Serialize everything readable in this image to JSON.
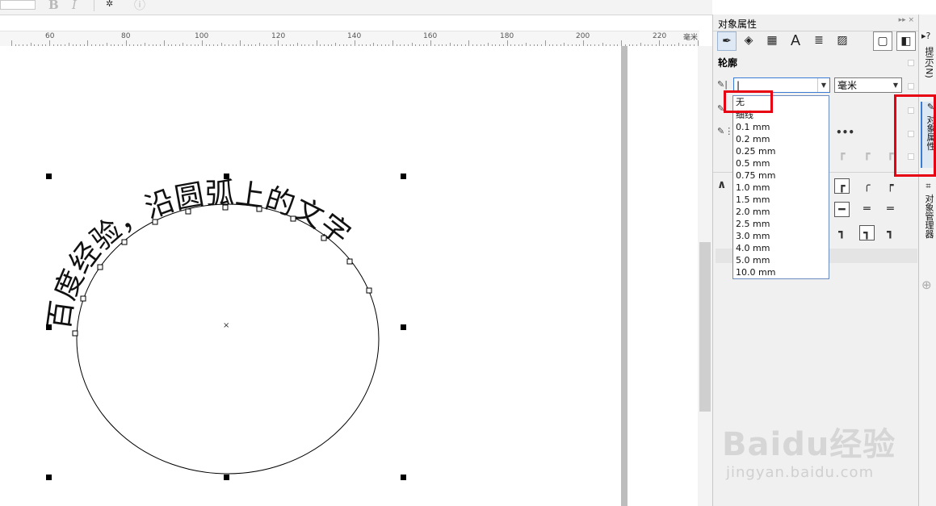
{
  "toolbar": {
    "bold_glyph": "B",
    "italic_glyph": "I",
    "settings_glyph": "✲",
    "info_glyph": "ⓘ"
  },
  "ruler": {
    "unit": "毫米",
    "labels": [
      "60",
      "80",
      "100",
      "120",
      "140",
      "160",
      "180",
      "200",
      "220"
    ]
  },
  "canvas": {
    "arc_text": "百度经验，沿圆弧上的文字",
    "center_mark": "×"
  },
  "panel": {
    "title": "对象属性",
    "header_arrows": "▸▸ ×",
    "tabs": [
      "outline-pen",
      "fill",
      "transparency",
      "character",
      "paragraph",
      "frame"
    ],
    "tab_glyphs": [
      "✒",
      "◈",
      "▦",
      "A",
      "≣",
      "▨",
      "▢",
      "◧"
    ],
    "section_title": "轮廓",
    "width_value": "|",
    "unit_value": "毫米",
    "dash_glyph": "•••",
    "arrow_glyph": "∧"
  },
  "width_dropdown": {
    "options": [
      "无",
      "细线",
      "0.1 mm",
      "0.2 mm",
      "0.25 mm",
      "0.5 mm",
      "0.75 mm",
      "1.0 mm",
      "1.5 mm",
      "2.0 mm",
      "2.5 mm",
      "3.0 mm",
      "4.0 mm",
      "5.0 mm",
      "10.0 mm"
    ],
    "highlighted": "无"
  },
  "side_tabs": {
    "tip_glyph": "▸?",
    "hints": "提示(N)",
    "object_properties": "对象属性",
    "object_manager": "对象管理器",
    "add_glyph": "⊕"
  },
  "watermark": {
    "logo": "Baidu经验",
    "url": "jingyan.baidu.com"
  },
  "colors": {
    "highlight_box": "#e60012",
    "dropdown_border": "#6a8cc0",
    "active_tab": "#dde8f5"
  }
}
